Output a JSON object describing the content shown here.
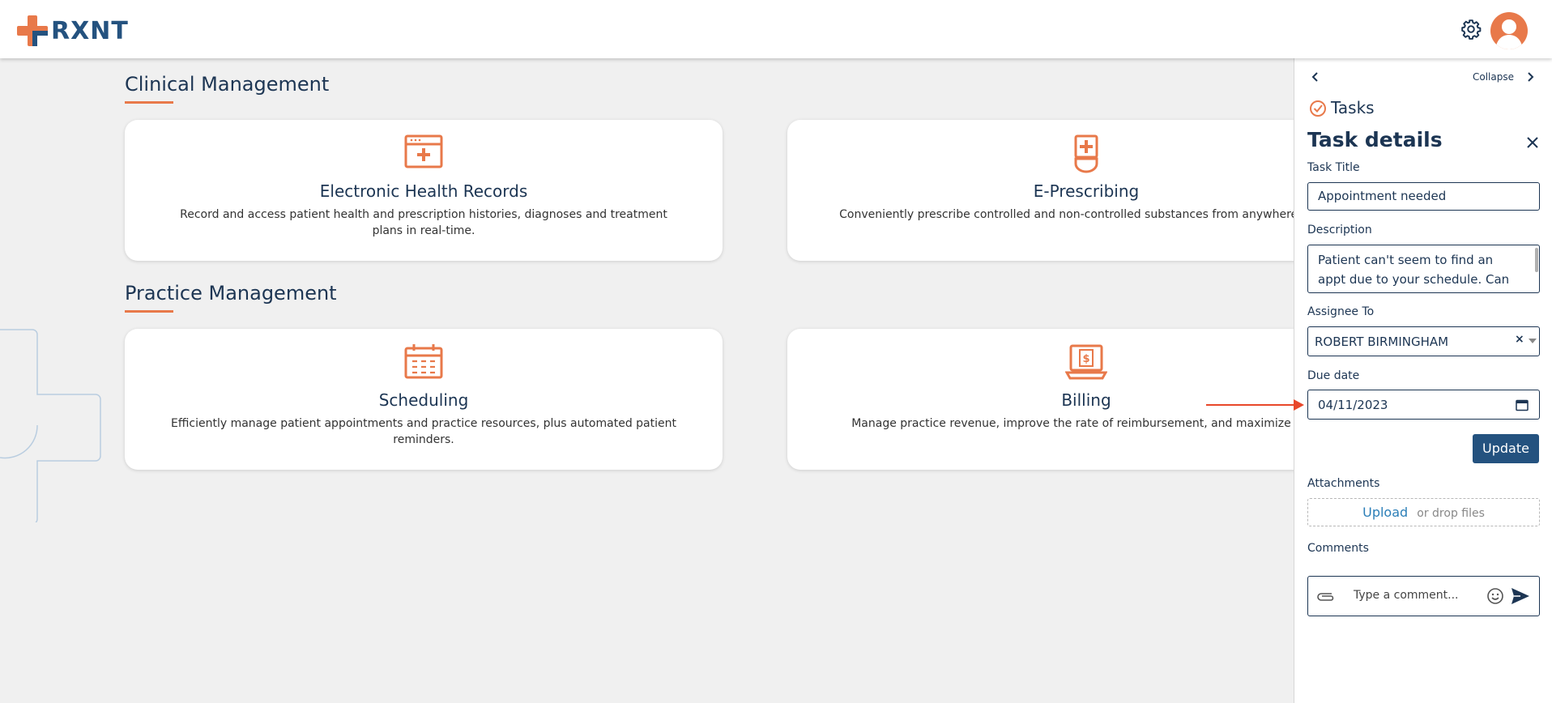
{
  "brand": {
    "name": "RXNT"
  },
  "sections": [
    {
      "title": "Clinical Management",
      "cards": [
        {
          "title": "Electronic Health Records",
          "desc": "Record and access patient health and prescription histories, diagnoses and treatment plans in real-time.",
          "icon": "ehr-icon"
        },
        {
          "title": "E-Prescribing",
          "desc": "Conveniently prescribe controlled and non-controlled substances from anywhere, at any time.",
          "icon": "prescription-bottle-icon"
        }
      ]
    },
    {
      "title": "Practice Management",
      "cards": [
        {
          "title": "Scheduling",
          "desc": "Efficiently manage patient appointments and practice resources, plus automated patient reminders.",
          "icon": "calendar-icon"
        },
        {
          "title": "Billing",
          "desc": "Manage practice revenue, improve the rate of reimbursement, and maximize profitability.",
          "icon": "billing-laptop-icon"
        }
      ]
    }
  ],
  "panel": {
    "collapse_label": "Collapse",
    "tasks_label": "Tasks",
    "heading": "Task details",
    "task_title_label": "Task Title",
    "task_title_value": "Appointment needed",
    "description_label": "Description",
    "description_value": "Patient can't seem to find an appt due to your schedule. Can",
    "assignee_label": "Assignee To",
    "assignee_value": "ROBERT BIRMINGHAM",
    "due_label": "Due date",
    "due_value": "04/11/2023",
    "update_label": "Update",
    "attachments_label": "Attachments",
    "upload_label": "Upload",
    "drop_label": "or drop files",
    "comments_label": "Comments",
    "comment_placeholder": "Type a comment..."
  },
  "colors": {
    "accent": "#e8794a",
    "navy": "#1c3553",
    "button": "#24527f",
    "link": "#2c7fb8",
    "annotation": "#e8472a"
  }
}
